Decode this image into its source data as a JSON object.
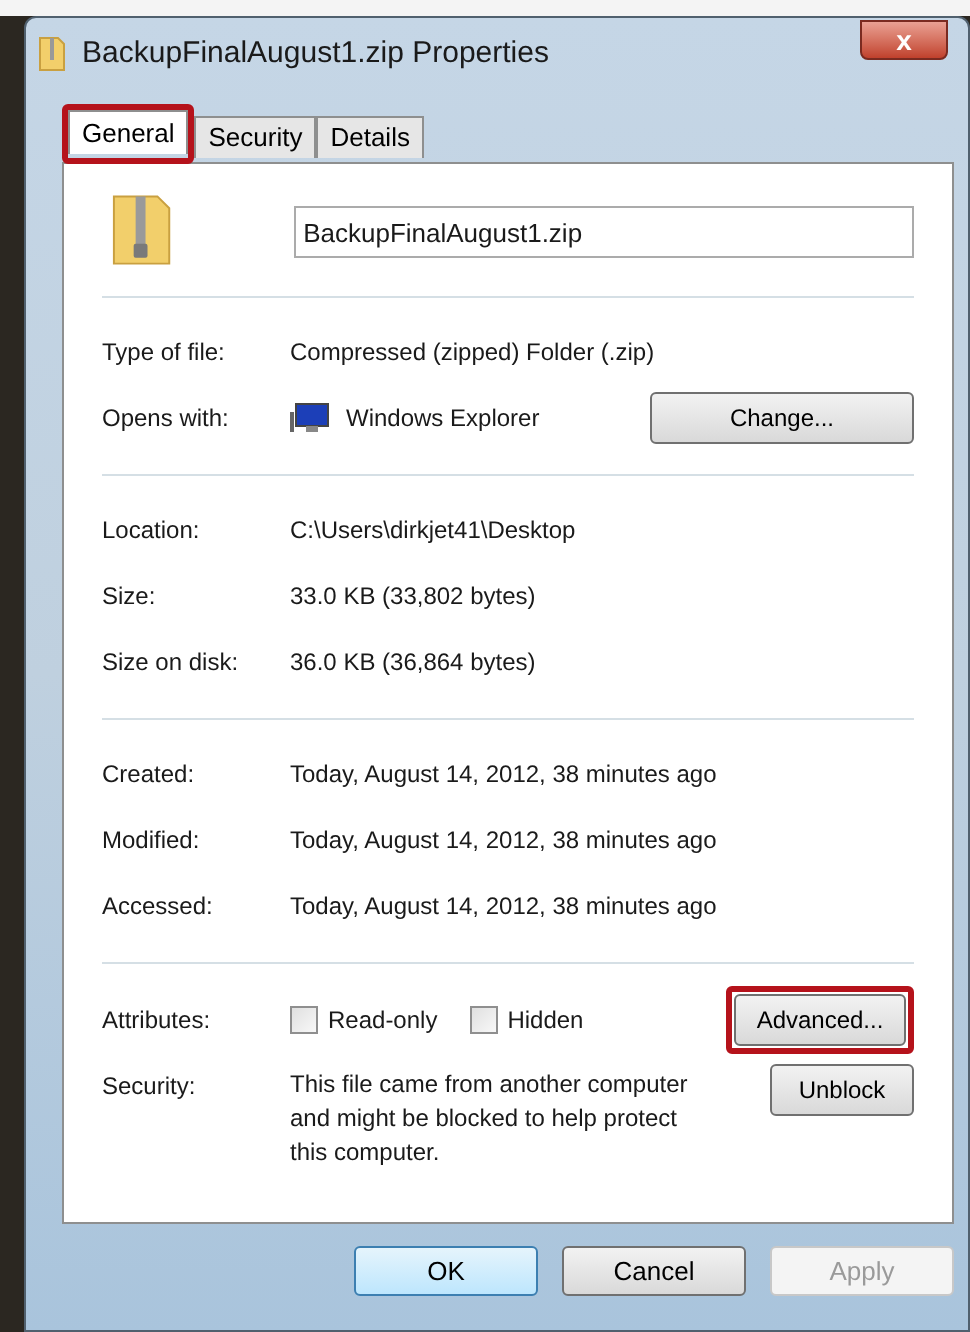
{
  "window": {
    "title": "BackupFinalAugust1.zip Properties",
    "close": "x"
  },
  "tabs": [
    {
      "label": "General",
      "selected": true,
      "highlighted": true
    },
    {
      "label": "Security",
      "selected": false,
      "highlighted": false
    },
    {
      "label": "Details",
      "selected": false,
      "highlighted": false
    }
  ],
  "file_name": {
    "value": "BackupFinalAugust1.zip"
  },
  "sections": [
    [
      {
        "kind": "text",
        "label": "Type of file:",
        "value": "Compressed (zipped) Folder (.zip)"
      },
      {
        "kind": "app",
        "label": "Opens with:",
        "value": "Windows Explorer",
        "button": {
          "label": "Change...",
          "highlighted": false
        }
      }
    ],
    [
      {
        "kind": "text",
        "label": "Location:",
        "value": "C:\\Users\\dirkjet41\\Desktop"
      },
      {
        "kind": "text",
        "label": "Size:",
        "value": "33.0 KB (33,802 bytes)"
      },
      {
        "kind": "text",
        "label": "Size on disk:",
        "value": "36.0 KB (36,864 bytes)"
      }
    ],
    [
      {
        "kind": "text",
        "label": "Created:",
        "value": "Today, August 14, 2012, 38 minutes ago"
      },
      {
        "kind": "text",
        "label": "Modified:",
        "value": "Today, August 14, 2012, 38 minutes ago"
      },
      {
        "kind": "text",
        "label": "Accessed:",
        "value": "Today, August 14, 2012, 38 minutes ago"
      }
    ],
    [
      {
        "kind": "attributes",
        "label": "Attributes:",
        "checkboxes": [
          {
            "label": "Read-only",
            "checked": false
          },
          {
            "label": "Hidden",
            "checked": false
          }
        ],
        "button": {
          "label": "Advanced...",
          "highlighted": true
        }
      },
      {
        "kind": "security",
        "label": "Security:",
        "value": "This file came from another computer and might be blocked to help protect this computer.",
        "button": {
          "label": "Unblock",
          "highlighted": false
        }
      }
    ]
  ],
  "buttons": [
    {
      "label": "OK",
      "kind": "default",
      "disabled": false
    },
    {
      "label": "Cancel",
      "kind": "normal",
      "disabled": false
    },
    {
      "label": "Apply",
      "kind": "normal",
      "disabled": true
    }
  ]
}
